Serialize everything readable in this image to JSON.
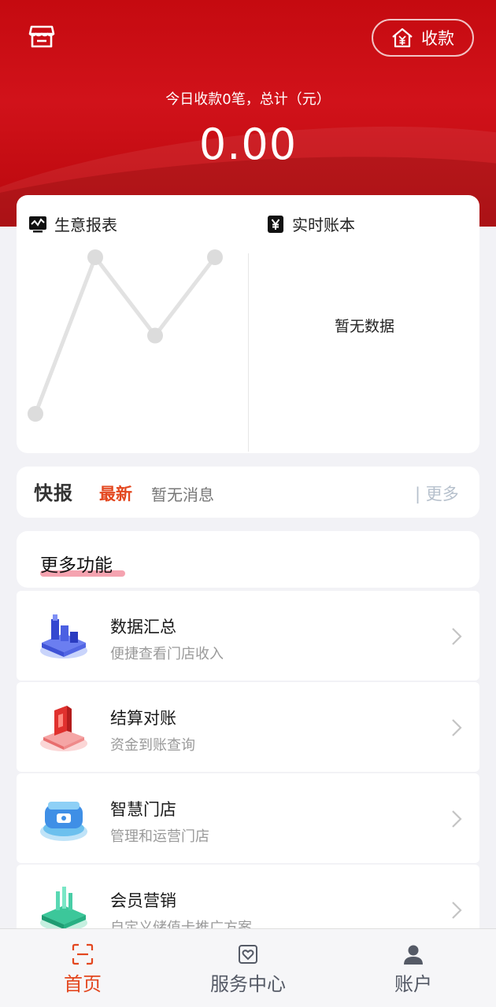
{
  "header": {
    "collect_label": "收款",
    "today_label": "今日收款0笔，总计（元）",
    "total_amount": "0.00",
    "brand_color": "#d1121a"
  },
  "report": {
    "title": "生意报表",
    "ledger_title": "实时账本",
    "no_data": "暂无数据",
    "chart_data": {
      "type": "line",
      "values": [
        0,
        1,
        0.5,
        1
      ],
      "line_color": "#e2e2e2"
    }
  },
  "news": {
    "logo": "快报",
    "latest": "最新",
    "message": "暂无消息",
    "more": "| 更多"
  },
  "more_functions": {
    "title": "更多功能",
    "items": [
      {
        "title": "数据汇总",
        "subtitle": "便捷查看门店收入",
        "icon": "data-summary-icon"
      },
      {
        "title": "结算对账",
        "subtitle": "资金到账查询",
        "icon": "settlement-icon"
      },
      {
        "title": "智慧门店",
        "subtitle": "管理和运营门店",
        "icon": "smart-store-icon"
      },
      {
        "title": "会员营销",
        "subtitle": "自定义储值卡推广方案",
        "icon": "member-marketing-icon"
      }
    ]
  },
  "tabbar": {
    "items": [
      {
        "label": "首页",
        "icon": "scan-home-icon",
        "active": true
      },
      {
        "label": "服务中心",
        "icon": "service-center-icon",
        "active": false
      },
      {
        "label": "账户",
        "icon": "account-icon",
        "active": false
      }
    ],
    "active_color": "#e3471f",
    "inactive_color": "#555a66"
  }
}
